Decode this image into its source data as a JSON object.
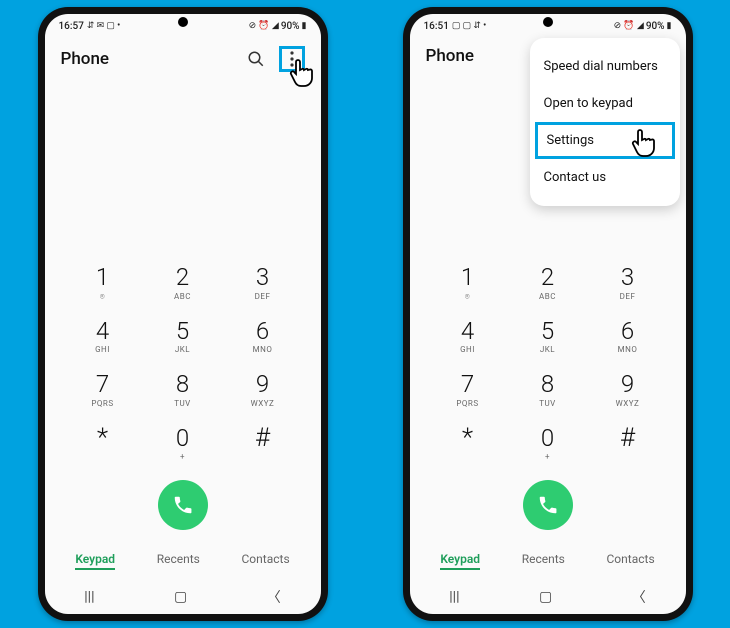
{
  "status": {
    "time_left": "16:57",
    "time_right": "16:51",
    "battery_text": "90%"
  },
  "header": {
    "title": "Phone"
  },
  "keypad": [
    [
      {
        "num": "1",
        "sub": " "
      },
      {
        "num": "2",
        "sub": "ABC"
      },
      {
        "num": "3",
        "sub": "DEF"
      }
    ],
    [
      {
        "num": "4",
        "sub": "GHI"
      },
      {
        "num": "5",
        "sub": "JKL"
      },
      {
        "num": "6",
        "sub": "MNO"
      }
    ],
    [
      {
        "num": "7",
        "sub": "PQRS"
      },
      {
        "num": "8",
        "sub": "TUV"
      },
      {
        "num": "9",
        "sub": "WXYZ"
      }
    ],
    [
      {
        "num": "*",
        "sub": ""
      },
      {
        "num": "0",
        "sub": "+"
      },
      {
        "num": "#",
        "sub": ""
      }
    ]
  ],
  "tabs": {
    "keypad": "Keypad",
    "recents": "Recents",
    "contacts": "Contacts"
  },
  "menu": {
    "speed_dial": "Speed dial numbers",
    "open_keypad": "Open to keypad",
    "settings": "Settings",
    "contact_us": "Contact us"
  }
}
